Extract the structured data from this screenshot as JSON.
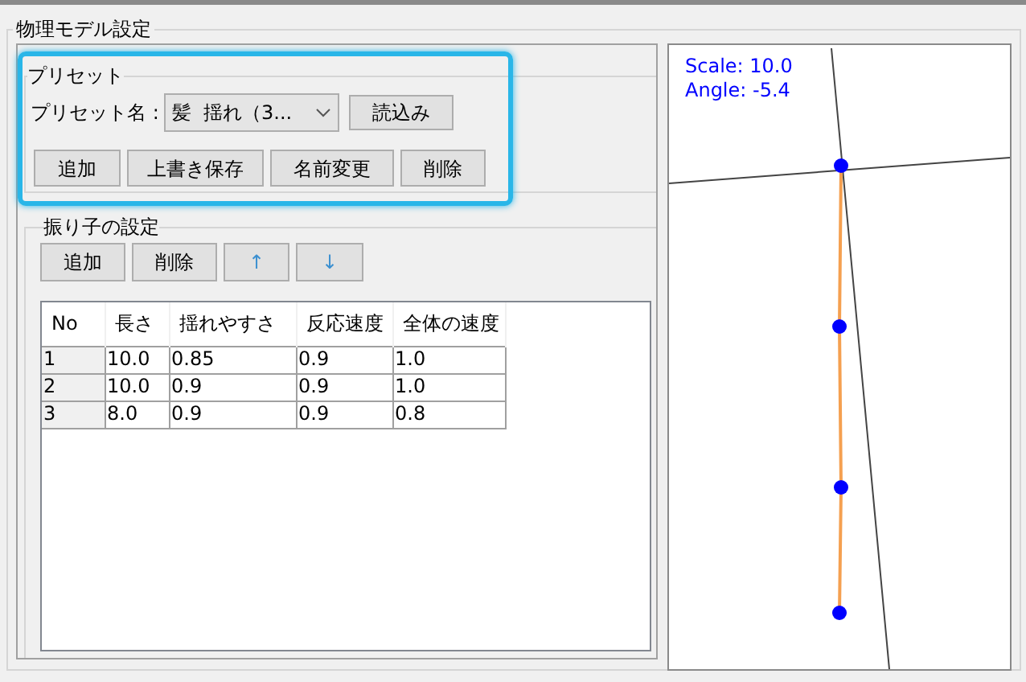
{
  "group_title": "物理モデル設定",
  "preset": {
    "title": "プリセット",
    "name_label": "プリセット名 :",
    "selected_preset": "髪  揺れ（3...",
    "load_button": "読込み",
    "highlighted": true,
    "buttons": [
      "追加",
      "上書き保存",
      "名前変更",
      "削除"
    ]
  },
  "pendulum": {
    "title": "振り子の設定",
    "buttons": [
      "追加",
      "削除",
      "↑",
      "↓"
    ],
    "table": {
      "columns": [
        "No",
        "長さ",
        "揺れやすさ",
        "反応速度",
        "全体の速度"
      ],
      "rows": [
        [
          "1",
          "10.0",
          "0.85",
          "0.9",
          "1.0"
        ],
        [
          "2",
          "10.0",
          "0.9",
          "0.9",
          "1.0"
        ],
        [
          "3",
          "8.0",
          "0.9",
          "0.9",
          "0.8"
        ]
      ]
    }
  },
  "canvas": {
    "scale_label": "Scale: 10.0",
    "angle_label": "Angle: -5.4"
  }
}
